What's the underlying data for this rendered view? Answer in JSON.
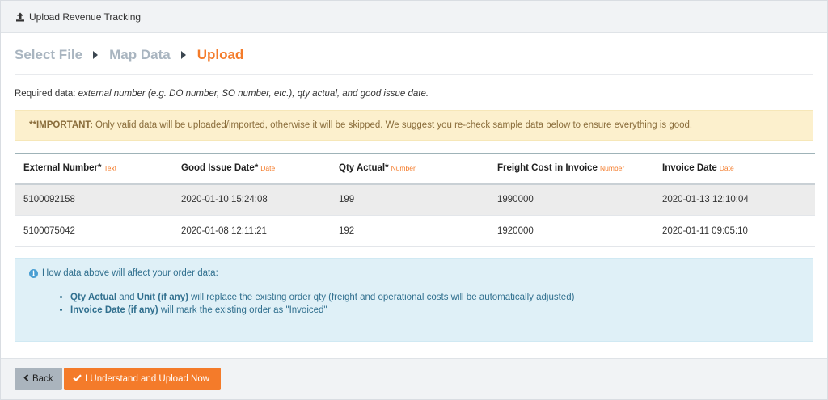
{
  "header": {
    "title": "Upload Revenue Tracking",
    "icon": "upload-icon"
  },
  "steps": [
    {
      "label": "Select File",
      "active": false
    },
    {
      "label": "Map Data",
      "active": false
    },
    {
      "label": "Upload",
      "active": true
    }
  ],
  "required": {
    "prefix": "Required data: ",
    "fields": "external number (e.g. DO number, SO number, etc.), qty actual, and good issue date."
  },
  "warning": {
    "strong": "**IMPORTANT:",
    "text": "Only valid data will be uploaded/imported, otherwise it will be skipped. We suggest you re-check sample data below to ensure everything is good."
  },
  "table": {
    "columns": [
      {
        "label": "External Number*",
        "type": "Text"
      },
      {
        "label": "Good Issue Date*",
        "type": "Date"
      },
      {
        "label": "Qty Actual*",
        "type": "Number"
      },
      {
        "label": "Freight Cost in Invoice",
        "type": "Number"
      },
      {
        "label": "Invoice Date",
        "type": "Date"
      }
    ],
    "rows": [
      [
        "5100092158",
        "2020-01-10 15:24:08",
        "199",
        "1990000",
        "2020-01-13 12:10:04"
      ],
      [
        "5100075042",
        "2020-01-08 12:11:21",
        "192",
        "1920000",
        "2020-01-11 09:05:10"
      ]
    ]
  },
  "info": {
    "heading": "How data above will affect your order data:",
    "item1": {
      "strong1": "Qty Actual",
      "and": " and ",
      "strong2": "Unit (if any)",
      "text": " will replace the existing order qty (freight and operational costs will be automatically adjusted)"
    },
    "item2": {
      "strong": "Invoice Date (if any)",
      "text": " will mark the existing order as \"Invoiced\""
    }
  },
  "footer": {
    "back_label": "Back",
    "upload_label": "I Understand and Upload Now"
  },
  "colors": {
    "accent": "#f47b2a",
    "step_inactive": "#a9b5c0",
    "warning_bg": "#fcf0cd",
    "info_bg": "#dff0f7"
  }
}
